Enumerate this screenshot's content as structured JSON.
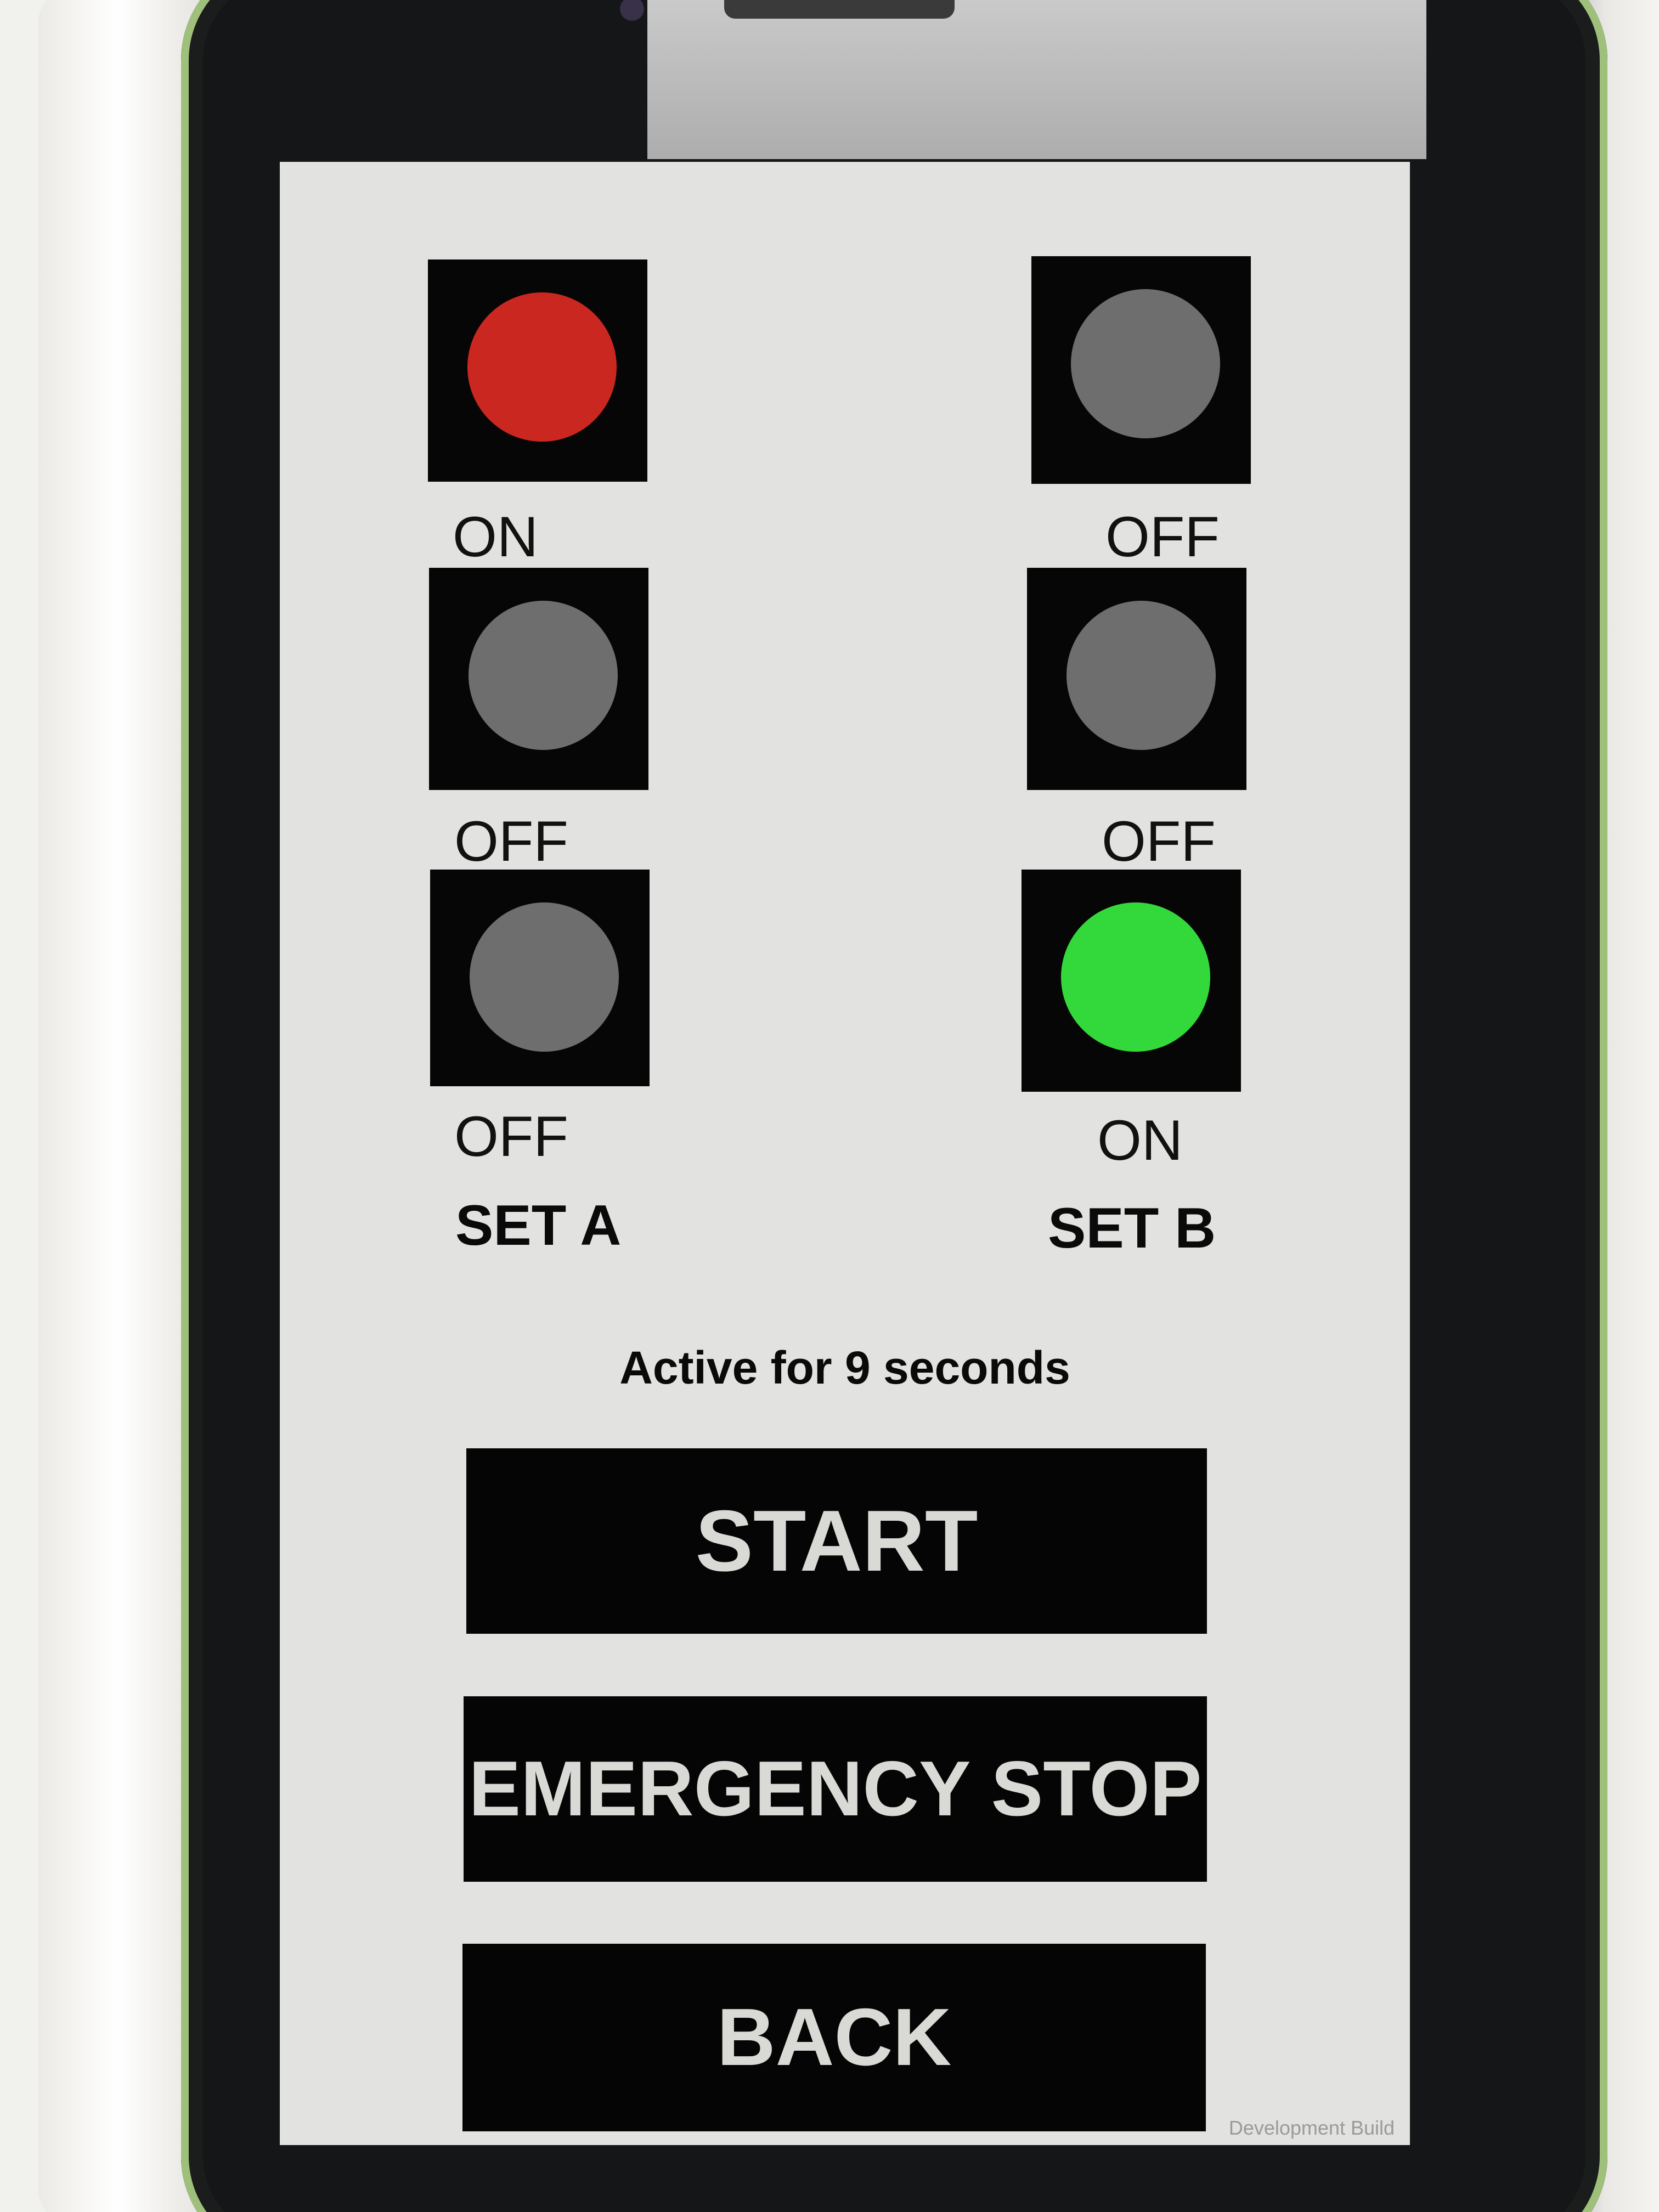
{
  "panel": {
    "set_a": {
      "label": "SET A",
      "lights": [
        {
          "state": "ON",
          "color": "#c9271f"
        },
        {
          "state": "OFF",
          "color": "#6e6e6e"
        },
        {
          "state": "OFF",
          "color": "#6e6e6e"
        }
      ]
    },
    "set_b": {
      "label": "SET B",
      "lights": [
        {
          "state": "OFF",
          "color": "#6e6e6e"
        },
        {
          "state": "OFF",
          "color": "#6e6e6e"
        },
        {
          "state": "ON",
          "color": "#33d93a"
        }
      ]
    }
  },
  "status": {
    "timer_text": "Active for 9 seconds"
  },
  "buttons": {
    "start": "START",
    "emergency_stop": "EMERGENCY STOP",
    "back": "BACK"
  },
  "footer": {
    "build_label": "Development Build"
  },
  "colors": {
    "screen_background": "#e2e3e0",
    "button_background": "#050505",
    "button_text": "#d9d9d6"
  }
}
